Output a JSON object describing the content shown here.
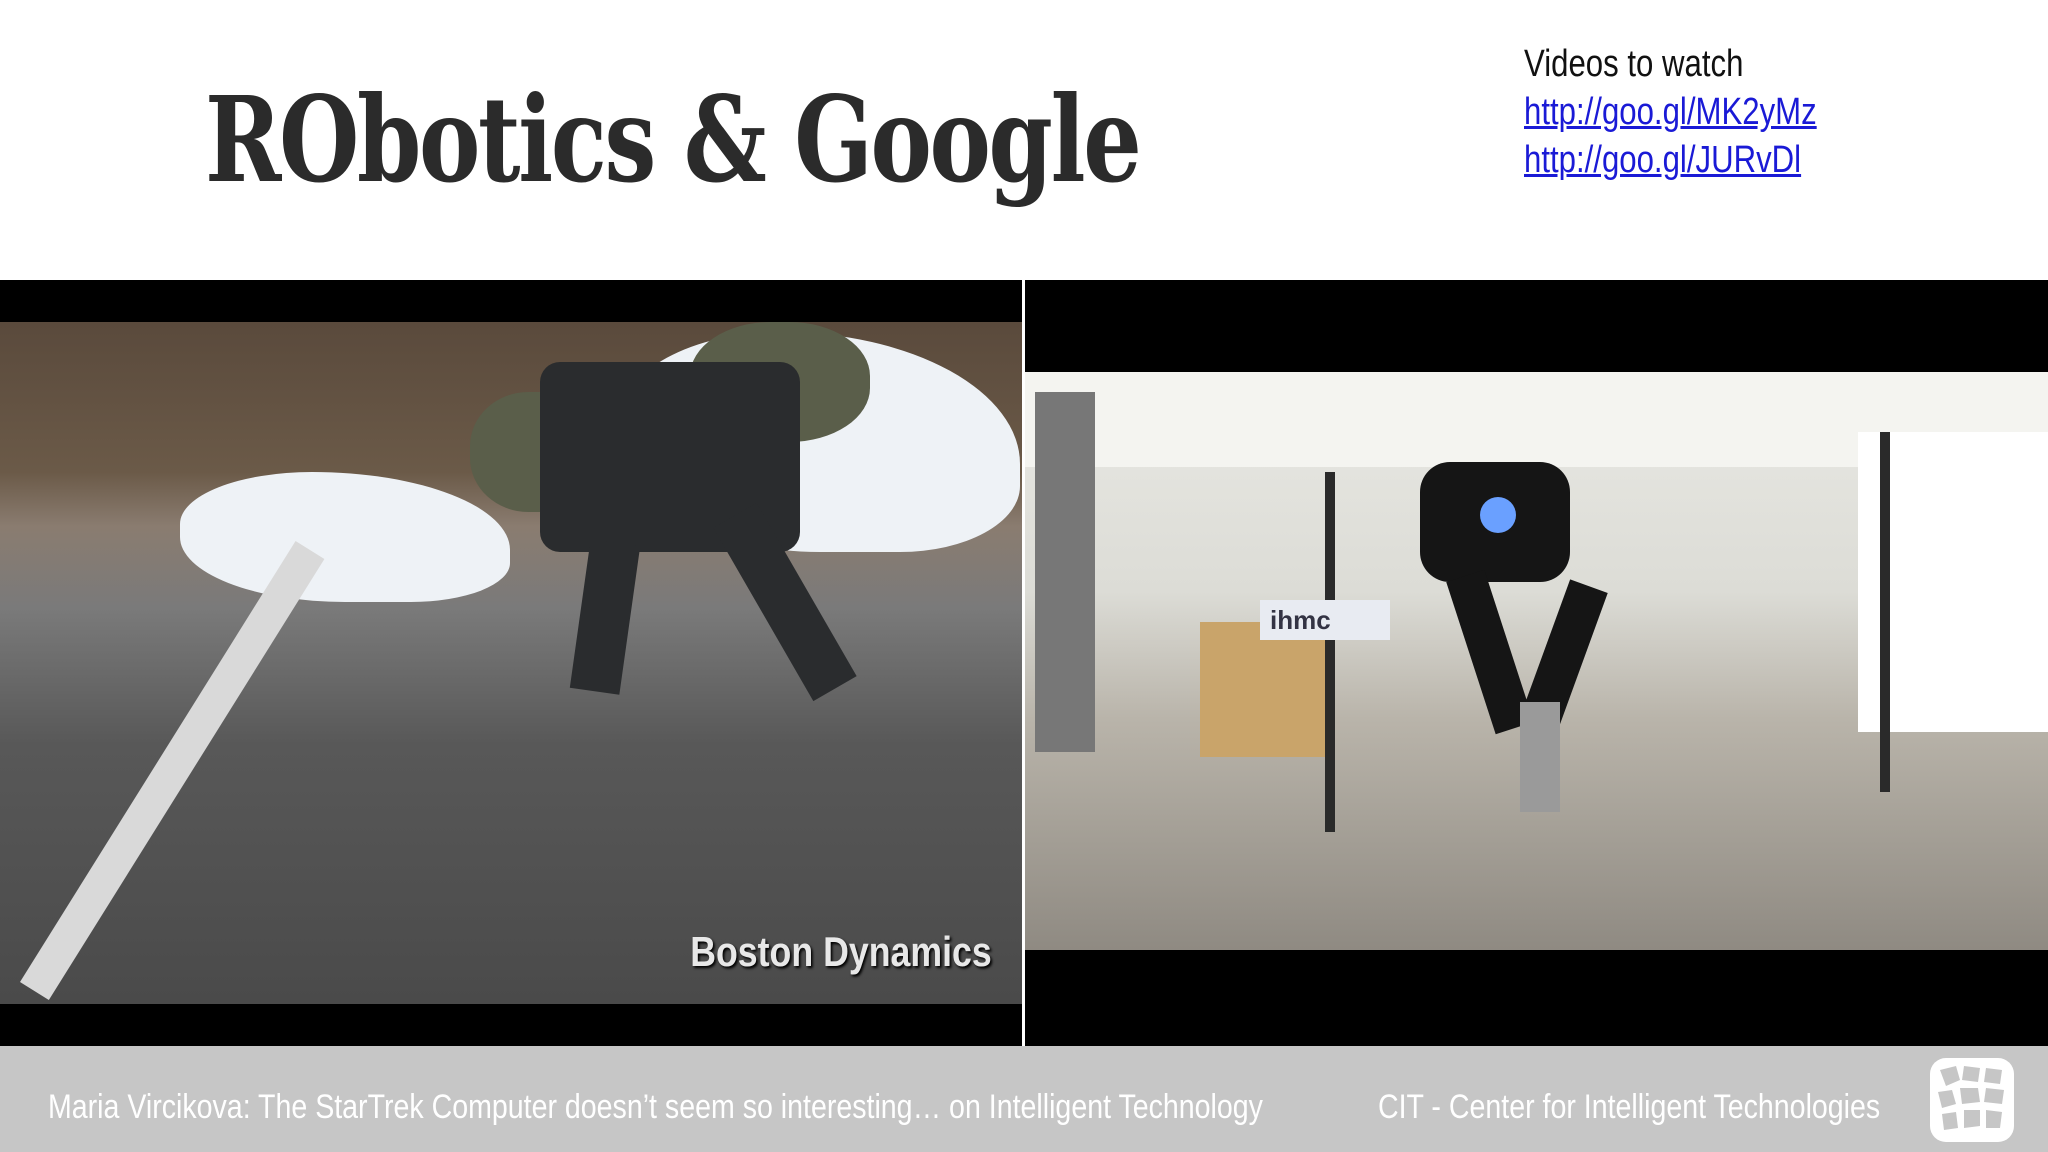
{
  "slide": {
    "title": "RObotics & Google",
    "videos_heading": "Videos to watch",
    "links": [
      "http://goo.gl/MK2yMz",
      "http://goo.gl/JURvDl"
    ]
  },
  "video_left": {
    "watermark": "Boston Dynamics"
  },
  "video_right": {
    "banner_text": "ihmc"
  },
  "footer": {
    "left_text": "Maria Vircikova: The StarTrek Computer doesn’t seem so interesting… on Intelligent Technology",
    "right_text": "CIT - Center for Intelligent Technologies",
    "logo_icon": "cit-logo-icon"
  },
  "colors": {
    "link": "#1a1ad6",
    "footer_bg": "#c6c6c6",
    "title": "#2b2b2b"
  }
}
